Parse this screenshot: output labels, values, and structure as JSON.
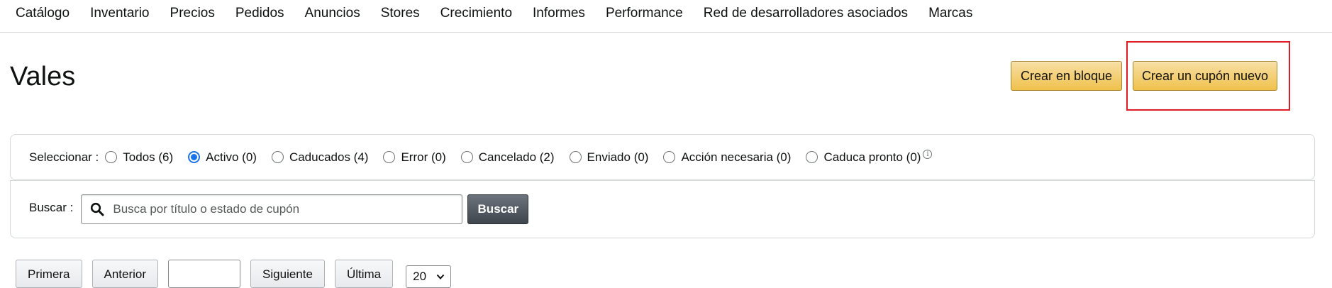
{
  "nav": {
    "items": [
      "Catálogo",
      "Inventario",
      "Precios",
      "Pedidos",
      "Anuncios",
      "Stores",
      "Crecimiento",
      "Informes",
      "Performance",
      "Red de desarrolladores asociados",
      "Marcas"
    ]
  },
  "header": {
    "title": "Vales",
    "bulk_button": "Crear en bloque",
    "new_button": "Crear un cupón nuevo"
  },
  "filter": {
    "label": "Seleccionar :",
    "options": [
      {
        "label": "Todos (6)",
        "checked": false
      },
      {
        "label": "Activo (0)",
        "checked": true
      },
      {
        "label": "Caducados (4)",
        "checked": false
      },
      {
        "label": "Error (0)",
        "checked": false
      },
      {
        "label": "Cancelado (2)",
        "checked": false
      },
      {
        "label": "Enviado (0)",
        "checked": false
      },
      {
        "label": "Acción necesaria (0)",
        "checked": false
      },
      {
        "label": "Caduca pronto (0)",
        "checked": false
      }
    ],
    "info_icon": "info-icon"
  },
  "search": {
    "label": "Buscar :",
    "placeholder": "Busca por título o estado de cupón",
    "value": "",
    "button": "Buscar"
  },
  "pagination": {
    "first": "Primera",
    "prev": "Anterior",
    "page_value": "",
    "next": "Siguiente",
    "last": "Última",
    "page_size": "20"
  },
  "colors": {
    "accent_yellow": "#f0c14b",
    "radio_blue": "#1a73e8",
    "highlight_red": "#e01b24",
    "dark_button": "#3f454d"
  }
}
